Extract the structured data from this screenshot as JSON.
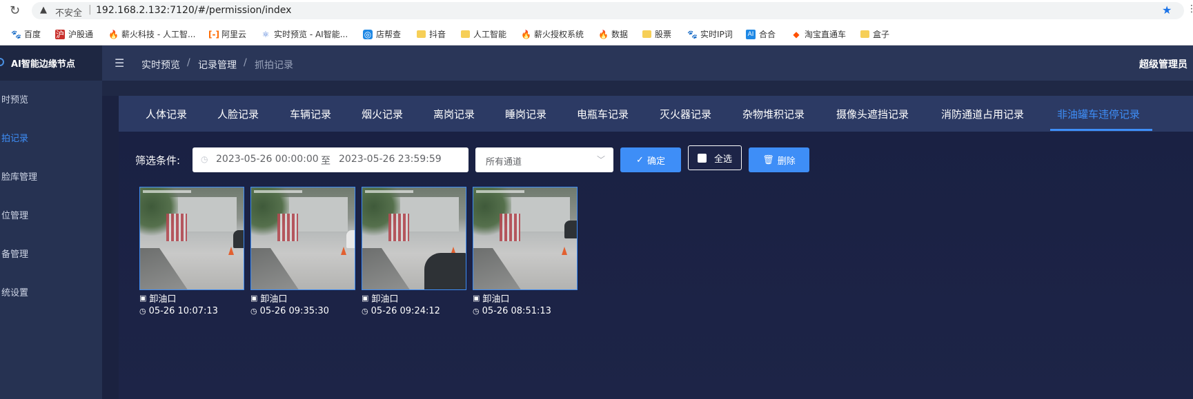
{
  "browser": {
    "security_label": "不安全",
    "url": "192.168.2.132:7120/#/permission/index",
    "bookmarks": [
      {
        "label": "百度",
        "icon": "baidu-icon"
      },
      {
        "label": "沪股通",
        "icon": "hgt-icon"
      },
      {
        "label": "薪火科技 - 人工智...",
        "icon": "fire-icon"
      },
      {
        "label": "阿里云",
        "icon": "aliyun-icon"
      },
      {
        "label": "实时预览 - AI智能...",
        "icon": "ai-icon"
      },
      {
        "label": "店帮查",
        "icon": "shop-icon"
      },
      {
        "label": "抖音",
        "icon": "folder-icon"
      },
      {
        "label": "人工智能",
        "icon": "folder-icon"
      },
      {
        "label": "薪火授权系统",
        "icon": "fire-icon"
      },
      {
        "label": "数据",
        "icon": "fire-icon"
      },
      {
        "label": "股票",
        "icon": "folder-icon"
      },
      {
        "label": "实时IP词",
        "icon": "paw-icon"
      },
      {
        "label": "合合",
        "icon": "ai-box-icon"
      },
      {
        "label": "淘宝直通车",
        "icon": "taobao-icon"
      },
      {
        "label": "盒子",
        "icon": "folder-icon"
      }
    ]
  },
  "app": {
    "brand": "AI智能边缘节点",
    "user": "超级管理员",
    "sidebar": [
      {
        "label": "实时预览"
      },
      {
        "label": "抓拍记录"
      },
      {
        "label": "人脸库管理"
      },
      {
        "label": "点位管理"
      },
      {
        "label": "设备管理"
      },
      {
        "label": "系统设置"
      }
    ],
    "sidebar_visible": [
      "时预览",
      "拍记录",
      "脸库管理",
      "位管理",
      "备管理",
      "统设置"
    ],
    "breadcrumb": [
      "实时预览",
      "记录管理",
      "抓拍记录"
    ],
    "tabs": [
      "人体记录",
      "人脸记录",
      "车辆记录",
      "烟火记录",
      "离岗记录",
      "睡岗记录",
      "电瓶车记录",
      "灭火器记录",
      "杂物堆积记录",
      "摄像头遮挡记录",
      "消防通道占用记录",
      "非油罐车违停记录"
    ],
    "active_tab": "非油罐车违停记录"
  },
  "filter": {
    "label": "筛选条件:",
    "start": "2023-05-26 00:00:00",
    "to": "至",
    "end": "2023-05-26 23:59:59",
    "channel": "所有通道",
    "confirm": "确定",
    "select_all": "全选",
    "delete": "删除"
  },
  "records": [
    {
      "location": "卸油口",
      "time": "05-26 10:07:13"
    },
    {
      "location": "卸油口",
      "time": "05-26 09:35:30"
    },
    {
      "location": "卸油口",
      "time": "05-26 09:24:12"
    },
    {
      "location": "卸油口",
      "time": "05-26 08:51:13"
    }
  ],
  "colors": {
    "accent": "#3e8ef7",
    "bg": "#1b2240",
    "sidebar": "#263252"
  }
}
